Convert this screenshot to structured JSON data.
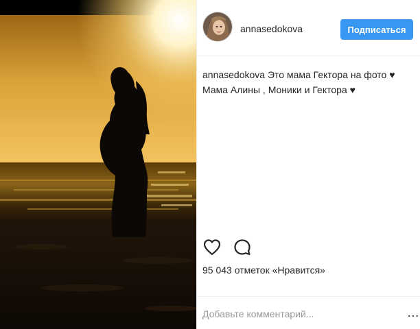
{
  "post": {
    "photo": {
      "sky_colors": [
        "#7a4a10",
        "#e0a030",
        "#f6d06a",
        "#fff6da"
      ],
      "sea_color": "#3a2606",
      "sand_color": "#150d06",
      "silhouette_color": "#0b0805"
    },
    "header": {
      "username": "annasedokova",
      "follow_label": "Подписаться"
    },
    "caption": {
      "username": "annasedokova",
      "text": " Это мама Гектора на фото ",
      "heart_1": "♥",
      "text_2": " Мама Алины , Моники и Гектора ",
      "heart_2": "♥"
    },
    "actions": {
      "like_icon": "heart-outline-icon",
      "comment_icon": "comment-bubble-icon"
    },
    "likes": "95 043 отметок «Нравится»",
    "comment": {
      "placeholder": "Добавьте комментарий...",
      "more": "…"
    },
    "colors": {
      "accent": "#3897f0",
      "text": "#262626",
      "placeholder": "#999999",
      "divider": "#efefef"
    }
  }
}
